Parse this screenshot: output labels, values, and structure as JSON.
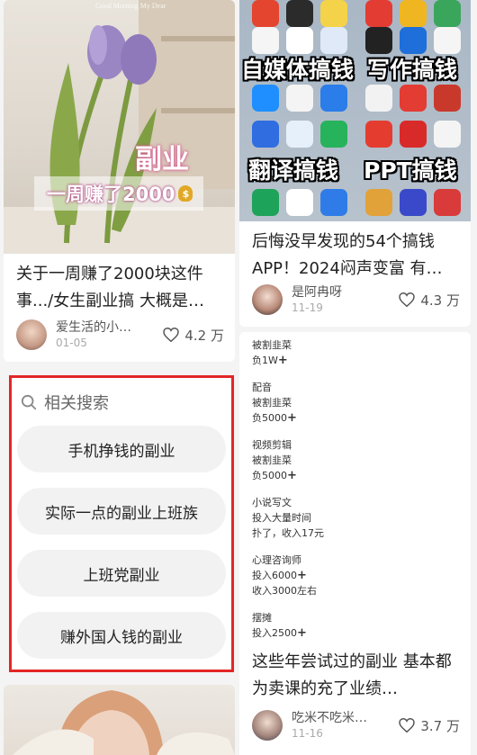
{
  "feed": {
    "left": [
      {
        "overlay_title": "副业",
        "overlay_sub": "一周赚了2000",
        "overlay_coin": "$",
        "overlay_small": "Good Morning My Dear",
        "title": "关于一周赚了2000块这件事.../女生副业搞 大概是…",
        "author": "爱生活的小…",
        "date": "01-05",
        "likes": "4.2 万"
      },
      {
        "title": "",
        "author": "",
        "date": "",
        "likes": ""
      }
    ],
    "right": [
      {
        "overlay_line1_a": "自媒体搞钱",
        "overlay_line1_b": "写作搞钱",
        "overlay_line2_a": "翻译搞钱",
        "overlay_line2_b": "PPT搞钱",
        "title": "后悔没早发现的54个搞钱APP！2024闷声变富 有…",
        "author": "是阿冉呀",
        "date": "11-19",
        "likes": "4.3 万"
      },
      {
        "list": [
          {
            "lines": [
              "被割韭菜",
              "负1W"
            ],
            "plus_on_last": true
          },
          {
            "lines": [
              "配音",
              "被割韭菜",
              "负5000"
            ],
            "plus_on_last": true
          },
          {
            "lines": [
              "视频剪辑",
              "被割韭菜",
              "负5000"
            ],
            "plus_on_last": true
          },
          {
            "lines": [
              "小说写文",
              "投入大量时间",
              "扑了，收入17元"
            ],
            "plus_on_last": false
          },
          {
            "lines": [
              "心理咨询师",
              "投入6000",
              "收入3000左右"
            ],
            "plus_line": 1
          },
          {
            "lines": [
              "摆摊",
              "投入2500"
            ],
            "plus_on_last": true
          }
        ],
        "title": "这些年尝试过的副业 基本都为卖课的充了业绩…",
        "author": "吃米不吃米…",
        "date": "11-16",
        "likes": "3.7 万"
      }
    ]
  },
  "related_search": {
    "heading": "相关搜索",
    "items": [
      "手机挣钱的副业",
      "实际一点的副业上班族",
      "上班党副业",
      "赚外国人钱的副业"
    ]
  },
  "colors": {
    "highlight_border": "#e32626",
    "pill_bg": "#f2f2f2"
  }
}
